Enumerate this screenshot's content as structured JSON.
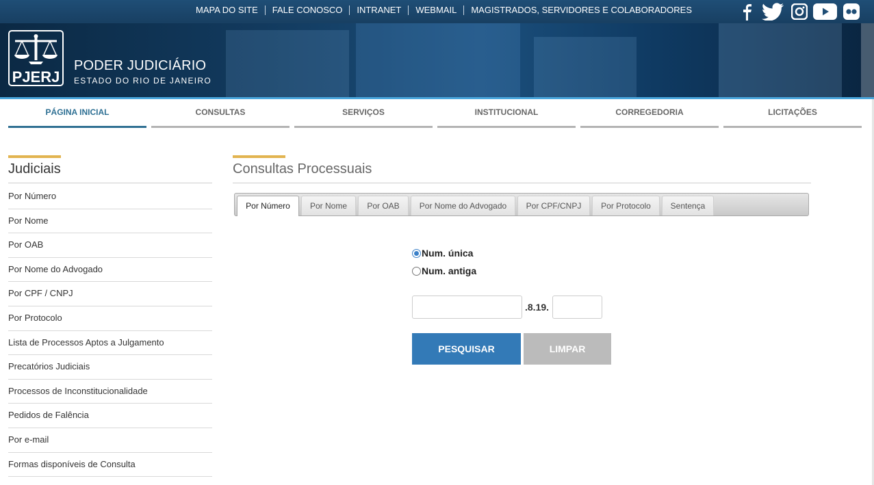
{
  "top_links": [
    "MAPA DO SITE",
    "FALE CONOSCO",
    "INTRANET",
    "WEBMAIL",
    "MAGISTRADOS, SERVIDORES E COLABORADORES"
  ],
  "social_icons": [
    "facebook-icon",
    "twitter-icon",
    "instagram-icon",
    "youtube-icon",
    "flickr-icon"
  ],
  "brand": {
    "logo_text": "PJERJ",
    "title": "PODER JUDICIÁRIO",
    "subtitle": "ESTADO DO RIO DE JANEIRO"
  },
  "nav": [
    {
      "label": "PÁGINA INICIAL",
      "active": true
    },
    {
      "label": "CONSULTAS"
    },
    {
      "label": "SERVIÇOS"
    },
    {
      "label": "INSTITUCIONAL"
    },
    {
      "label": "CORREGEDORIA"
    },
    {
      "label": "LICITAÇÕES"
    }
  ],
  "sidebar": {
    "title": "Judiciais",
    "items": [
      "Por Número",
      "Por Nome",
      "Por OAB",
      "Por Nome do Advogado",
      "Por CPF / CNPJ",
      "Por Protocolo",
      "Lista de Processos Aptos a Julgamento",
      "Precatórios Judiciais",
      "Processos de Inconstitucionalidade",
      "Pedidos de Falência",
      "Por e-mail",
      "Formas disponíveis de Consulta"
    ]
  },
  "main": {
    "title": "Consultas Processuais",
    "tabs": [
      {
        "label": "Por Número",
        "active": true
      },
      {
        "label": "Por Nome"
      },
      {
        "label": "Por OAB"
      },
      {
        "label": "Por Nome do Advogado"
      },
      {
        "label": "Por CPF/CNPJ"
      },
      {
        "label": "Por Protocolo"
      },
      {
        "label": "Sentença"
      }
    ],
    "radios": [
      {
        "label": "Num. única",
        "checked": true
      },
      {
        "label": "Num. antiga",
        "checked": false
      }
    ],
    "number_first_value": "",
    "number_separator": ".8.19.",
    "number_second_value": "",
    "search_button": "PESQUISAR",
    "clear_button": "LIMPAR"
  },
  "colors": {
    "accent_gold": "#e2b450",
    "primary_blue": "#337ab7",
    "active_nav": "#2f6f92",
    "topbar": "#1f4e76"
  }
}
